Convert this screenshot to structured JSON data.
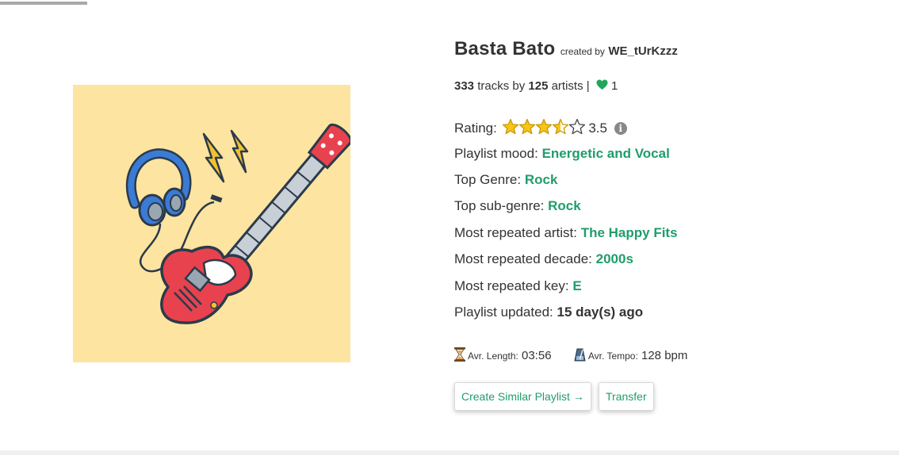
{
  "playlist": {
    "title": "Basta Bato",
    "created_by_label": "created by",
    "creator": "WE_tUrKzzz",
    "cover_icon": "guitar-headphones-illustration"
  },
  "stats": {
    "track_count": "333",
    "tracks_label": "tracks by",
    "artist_count": "125",
    "artists_label": "artists |",
    "likes": "1",
    "like_icon": "heart-icon"
  },
  "rating": {
    "label": "Rating:",
    "value": 3.5,
    "value_text": "3.5",
    "max": 5,
    "info_icon": "info-icon"
  },
  "attributes": [
    {
      "label": "Playlist mood:",
      "value": "Energetic and Vocal"
    },
    {
      "label": "Top Genre:",
      "value": "Rock"
    },
    {
      "label": "Top sub-genre:",
      "value": "Rock"
    },
    {
      "label": "Most repeated artist:",
      "value": "The Happy Fits"
    },
    {
      "label": "Most repeated decade:",
      "value": "2000s"
    },
    {
      "label": "Most repeated key:",
      "value": "E"
    },
    {
      "label": "Playlist updated:",
      "value": "15 day(s) ago"
    }
  ],
  "meta": {
    "length_icon": "hourglass-icon",
    "length_label": "Avr. Length:",
    "length_value": "03:56",
    "tempo_icon": "metronome-icon",
    "tempo_label": "Avr. Tempo:",
    "tempo_value": "128 bpm"
  },
  "buttons": {
    "similar": "Create Similar Playlist →",
    "transfer": "Transfer"
  },
  "colors": {
    "accent": "#1f9d6b",
    "star": "#f5c518",
    "cover_bg": "#fde4a0",
    "heart": "#1fa85a"
  }
}
